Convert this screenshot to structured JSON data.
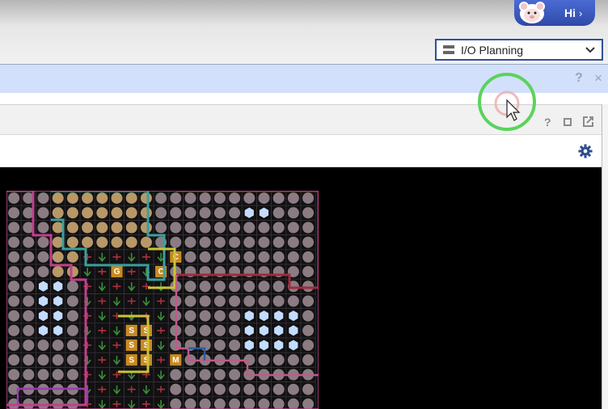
{
  "header": {
    "assistant_button_label": "Hi",
    "assistant_button_chevron": "›"
  },
  "layout_selector": {
    "value": "I/O Planning",
    "icon": "layout-icon"
  },
  "window_controls": {
    "help": "?",
    "close": "×"
  },
  "panel": {
    "help": "?",
    "icons": [
      "maximize-icon",
      "float-icon",
      "gear-icon"
    ]
  },
  "package_view": {
    "description_icon": "package-pin-grid",
    "colors": {
      "bank_magenta": "#c0408c",
      "bank_teal": "#3aa0a0",
      "bank_yellow": "#c9c43a",
      "bank_red": "#a02a3c",
      "bank_blue": "#2e5aa0",
      "pin_grey": "#8a7c82",
      "pin_tan": "#b89868",
      "pin_lightblue": "#c4dcff"
    },
    "pin_labels": [
      "S",
      "C",
      "G",
      "M"
    ]
  },
  "cursor": {
    "highlight_colors": [
      "#4cd44c",
      "#e88888"
    ]
  }
}
